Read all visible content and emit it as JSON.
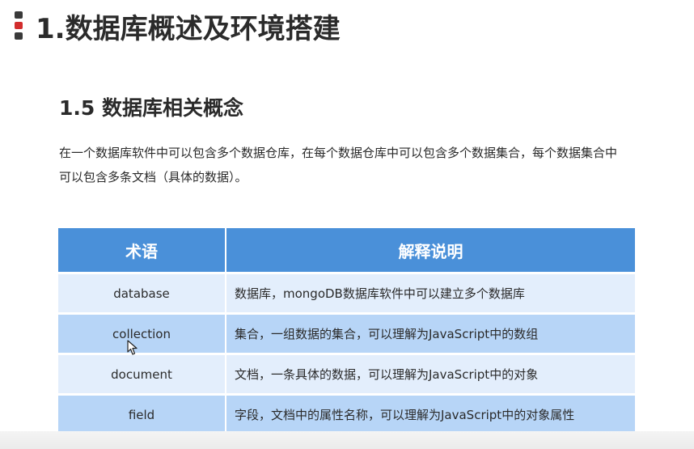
{
  "slide": {
    "title": "1.数据库概述及环境搭建",
    "section_title": "1.5 数据库相关概念",
    "intro_text": "在一个数据库软件中可以包含多个数据仓库，在每个数据仓库中可以包含多个数据集合，每个数据集合中可以包含多条文档（具体的数据）。"
  },
  "table": {
    "headers": [
      "术语",
      "解释说明"
    ],
    "rows": [
      {
        "term": "database",
        "desc": "数据库，mongoDB数据库软件中可以建立多个数据库"
      },
      {
        "term": "collection",
        "desc": "集合，一组数据的集合，可以理解为JavaScript中的数组"
      },
      {
        "term": "document",
        "desc": "文档，一条具体的数据，可以理解为JavaScript中的对象"
      },
      {
        "term": "field",
        "desc": "字段，文档中的属性名称，可以理解为JavaScript中的对象属性"
      }
    ]
  },
  "colors": {
    "header_bg": "#4a90d9",
    "row_light": "#e3eefc",
    "row_dark": "#b7d5f7",
    "marker_red": "#d22d2d"
  },
  "icons": [
    "title-marker-icon",
    "mouse-cursor-icon"
  ]
}
